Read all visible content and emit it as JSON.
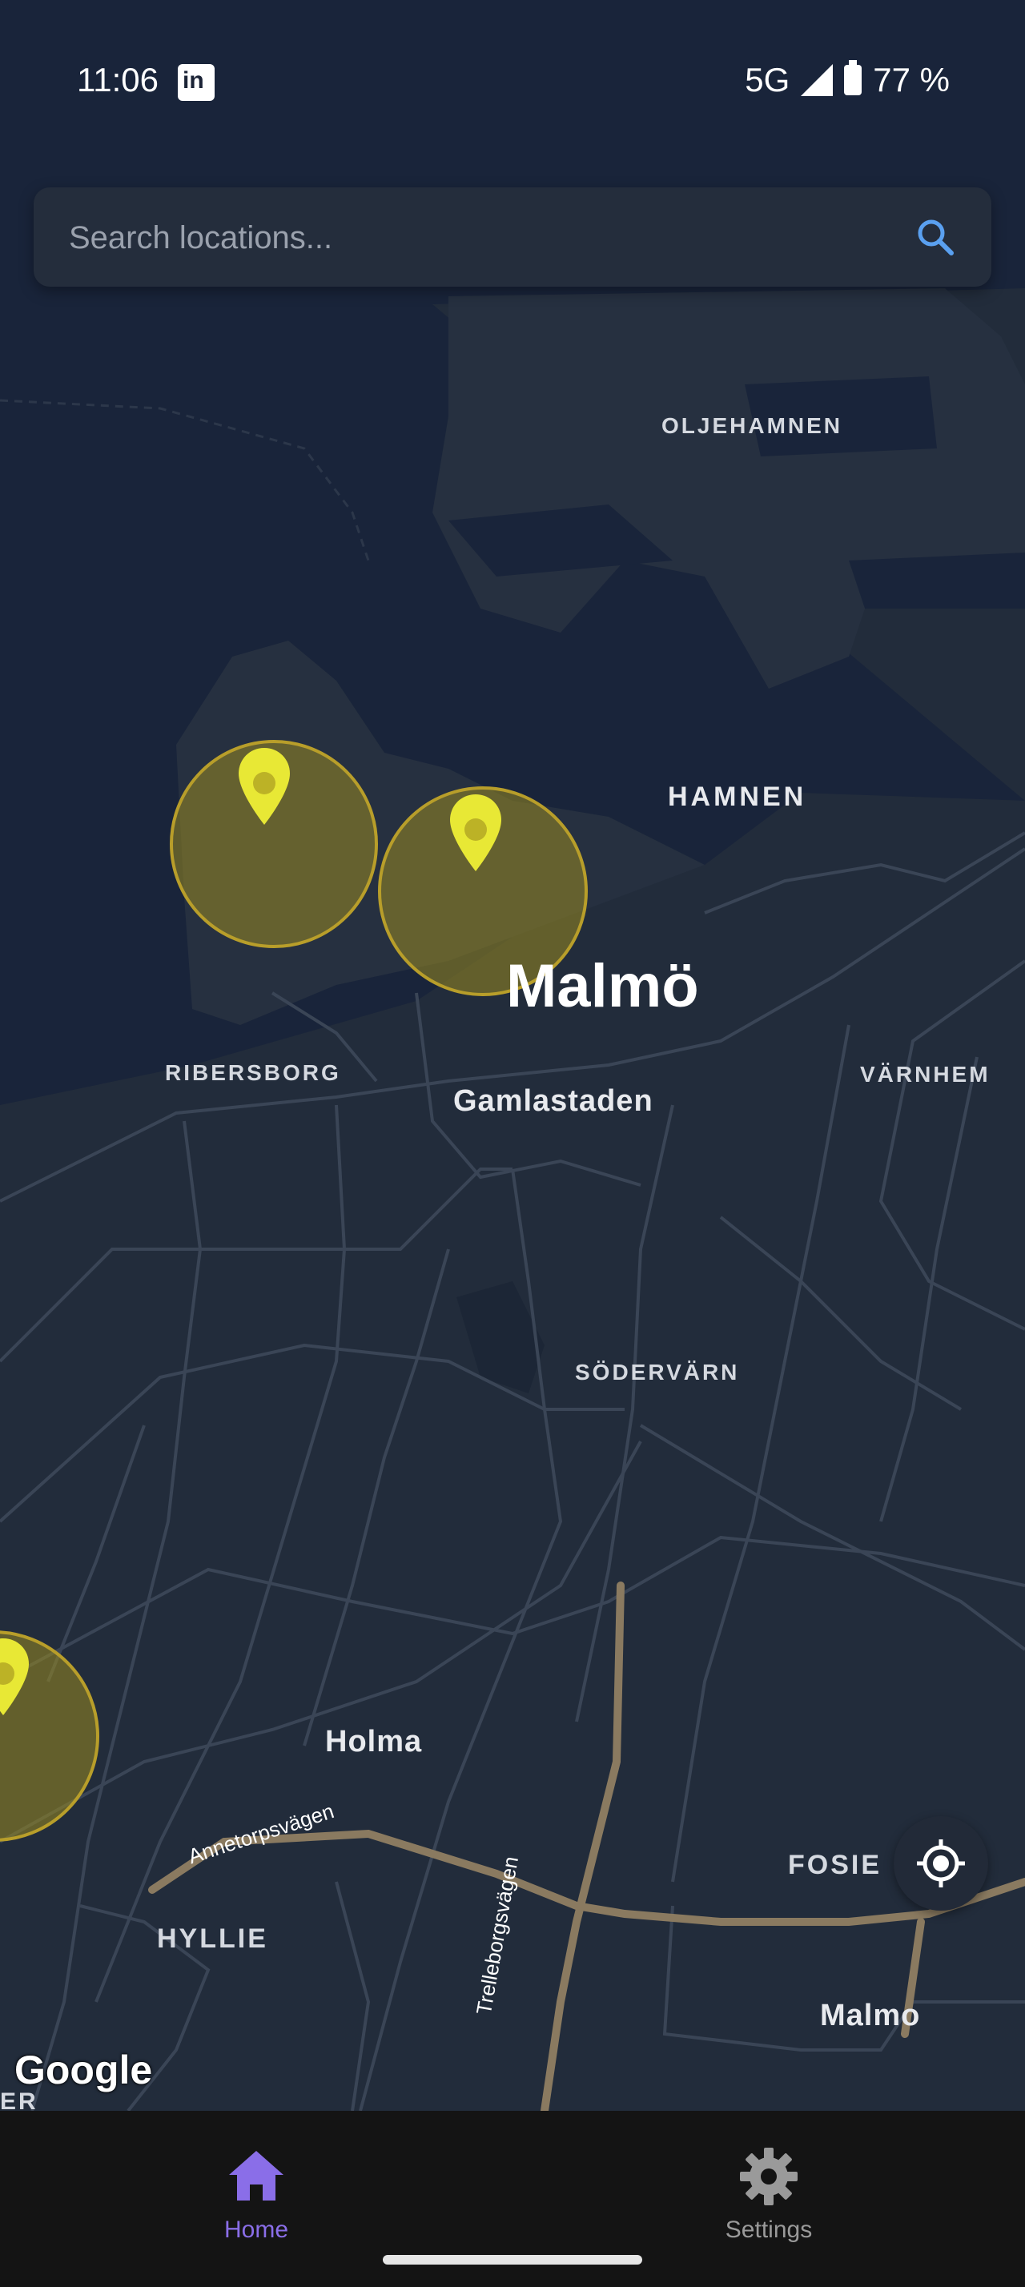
{
  "status_bar": {
    "time": "11:06",
    "app_icon": "linkedin-icon",
    "app_icon_text": "in",
    "network": "5G",
    "battery": "77 %"
  },
  "search": {
    "placeholder": "Search locations...",
    "icon": "search-icon"
  },
  "map": {
    "labels": {
      "oljehamnen": "OLJEHAMNEN",
      "hamnen": "HAMNEN",
      "city": "Malmö",
      "ribersborg": "RIBERSBORG",
      "gamlastaden": "Gamlastaden",
      "varnhem": "VÄRNHEM",
      "sodervarn": "SÖDERVÄRN",
      "holma": "Holma",
      "annetorpsvagen": "Annetorpsvägen",
      "fosie": "FOSIE",
      "hyllie": "HYLLIE",
      "trelleborgsvagen": "Trelleborgsvägen",
      "malmo_lower": "Malmo",
      "edge": "ER"
    },
    "attribution": "Google",
    "colors": {
      "water": "#19243a",
      "land": "#222c3b",
      "road": "#3a4556",
      "highway": "#8a7a60",
      "marker": "#e8e835",
      "geofence_fill": "#998b20",
      "geofence_border": "#b89e2a"
    }
  },
  "locate_button": {
    "icon": "my-location-icon"
  },
  "bottom_nav": {
    "items": [
      {
        "label": "Home",
        "icon": "home-icon",
        "active": true
      },
      {
        "label": "Settings",
        "icon": "gear-icon",
        "active": false
      }
    ],
    "active_color": "#8a6ee8",
    "inactive_color": "#9a9a9a"
  }
}
